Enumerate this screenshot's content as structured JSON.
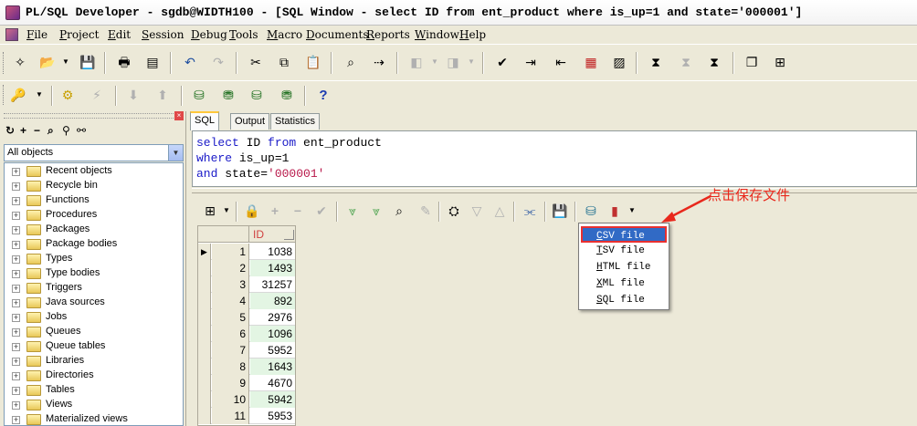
{
  "window": {
    "title": "PL/SQL Developer - sgdb@WIDTH100 - [SQL Window - select ID from ent_product where is_up=1 and state='000001']"
  },
  "menu": [
    "File",
    "Project",
    "Edit",
    "Session",
    "Debug",
    "Tools",
    "Macro",
    "Documents",
    "Reports",
    "Window",
    "Help"
  ],
  "help_button": "?",
  "browser": {
    "filter": "All objects",
    "close": "×",
    "items": [
      "Recent objects",
      "Recycle bin",
      "Functions",
      "Procedures",
      "Packages",
      "Package bodies",
      "Types",
      "Type bodies",
      "Triggers",
      "Java sources",
      "Jobs",
      "Queues",
      "Queue tables",
      "Libraries",
      "Directories",
      "Tables",
      "Views",
      "Materialized views"
    ]
  },
  "tabs": [
    "SQL",
    "Output",
    "Statistics"
  ],
  "sql": {
    "line1_kw1": "select",
    "line1_rest": " ID ",
    "line1_kw2": "from",
    "line1_tail": " ent_product",
    "line2_kw": "where",
    "line2_rest": " is_up=1",
    "line3_kw": "and",
    "line3_rest": " state=",
    "line3_str": "'000001'"
  },
  "results": {
    "column": "ID",
    "current_row_marker": "▶",
    "rows": [
      {
        "num": "1",
        "id": "1038"
      },
      {
        "num": "2",
        "id": "1493"
      },
      {
        "num": "3",
        "id": "31257"
      },
      {
        "num": "4",
        "id": "892"
      },
      {
        "num": "5",
        "id": "2976"
      },
      {
        "num": "6",
        "id": "1096"
      },
      {
        "num": "7",
        "id": "5952"
      },
      {
        "num": "8",
        "id": "1643"
      },
      {
        "num": "9",
        "id": "4670"
      },
      {
        "num": "10",
        "id": "5942"
      },
      {
        "num": "11",
        "id": "5953"
      }
    ]
  },
  "export_menu": {
    "items": [
      "CSV file",
      "TSV file",
      "HTML file",
      "XML file",
      "SQL file"
    ],
    "selected": "CSV file"
  },
  "annotation": {
    "text": "点击保存文件",
    "color": "#e8281c"
  },
  "colors": {
    "menu_highlight": "#316ac5",
    "alt_row": "#e3f5e3",
    "sql_keyword": "#1a1ac8",
    "sql_string": "#b8184a"
  }
}
